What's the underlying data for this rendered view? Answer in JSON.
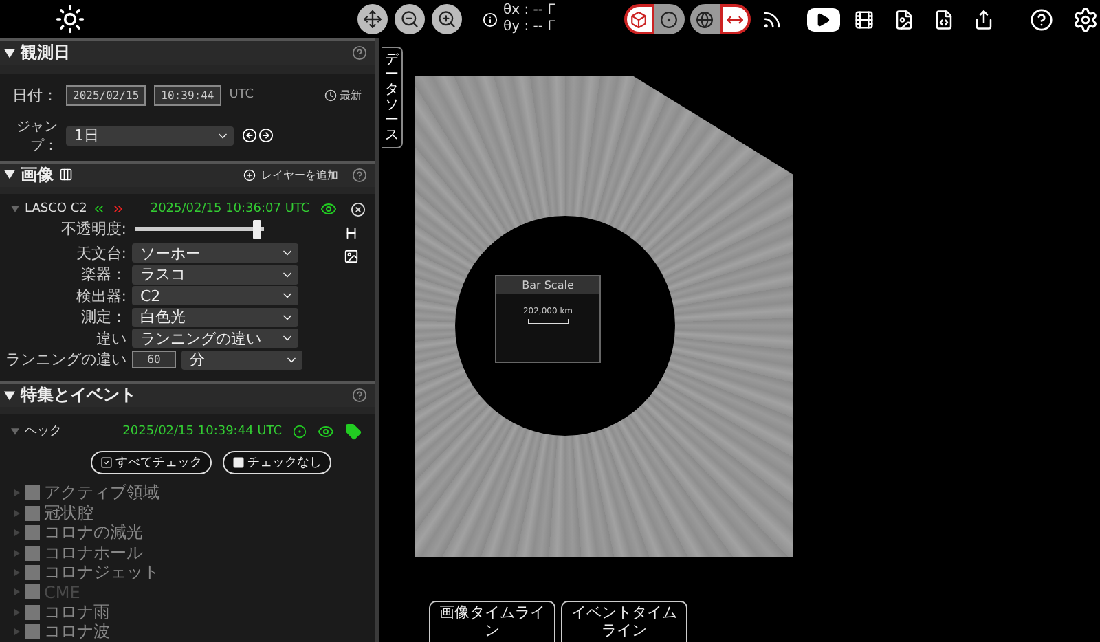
{
  "toolbar": {
    "coords": [
      "θx : -- Γ",
      "θy : -- Γ"
    ]
  },
  "observation_date": {
    "title": "観測日",
    "date_label": "日付：",
    "date": "2025/02/15",
    "time": "10:39:44",
    "timezone": "UTC",
    "latest": "最新",
    "jump_label": "ジャンプ：",
    "jump_value": "1日"
  },
  "images": {
    "title": "画像",
    "add_layer": "レイヤーを追加",
    "layer": {
      "name": "LASCO C2",
      "timestamp": "2025/02/15 10:36:07 UTC",
      "opacity_label": "不透明度:",
      "opacity": {
        "level": 0.95
      },
      "fields": [
        {
          "label": "天文台:",
          "value": "ソーホー"
        },
        {
          "label": "楽器：",
          "value": "ラスコ"
        },
        {
          "label": "検出器:",
          "value": "C2"
        },
        {
          "label": "測定：",
          "value": "白色光"
        },
        {
          "label": "違い",
          "value": "ランニングの違い"
        }
      ],
      "running_label": "ランニングの違い",
      "running_value": "60",
      "running_unit": "分"
    }
  },
  "events": {
    "title": "特集とイベント",
    "source": {
      "name": "ヘック",
      "timestamp": "2025/02/15 10:39:44 UTC"
    },
    "check_all": "すべてチェック",
    "check_none": "チェックなし",
    "items": [
      {
        "name": "アクティブ領域",
        "checked": false,
        "disabled": false
      },
      {
        "name": "冠状腔",
        "checked": false,
        "disabled": false
      },
      {
        "name": "コロナの減光",
        "checked": false,
        "disabled": false
      },
      {
        "name": "コロナホール",
        "checked": false,
        "disabled": false
      },
      {
        "name": "コロナジェット",
        "checked": false,
        "disabled": false
      },
      {
        "name": "CME",
        "checked": false,
        "disabled": true
      },
      {
        "name": "コロナ雨",
        "checked": false,
        "disabled": false
      },
      {
        "name": "コロナ波",
        "checked": false,
        "disabled": false
      }
    ]
  },
  "viewport": {
    "data_sources_tab": "データソース",
    "scale": {
      "title": "Bar Scale",
      "distance": "202,000 km"
    }
  },
  "timelines": [
    "画像タイムライン",
    "イベントタイムライン"
  ]
}
